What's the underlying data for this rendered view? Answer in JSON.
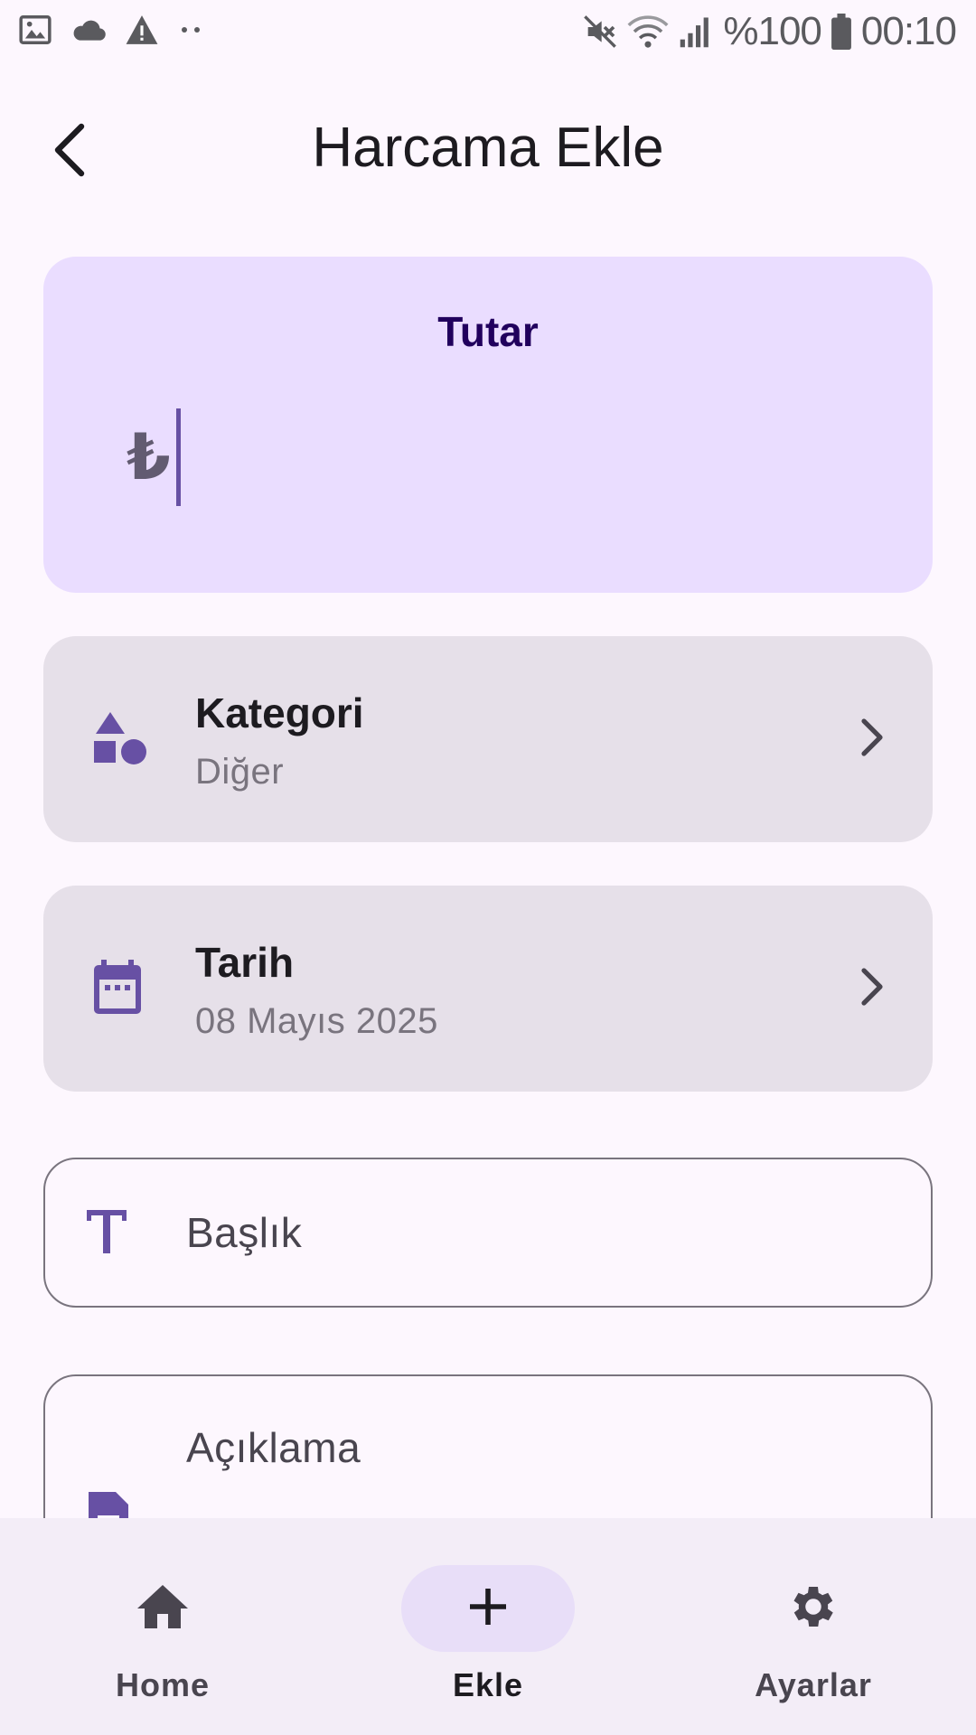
{
  "status_bar": {
    "battery": "%100",
    "time": "00:10",
    "left_icons": [
      "image-icon",
      "cloud-icon",
      "warning-icon",
      "more-dots-icon"
    ],
    "right_icons": [
      "mute-icon",
      "wifi-icon",
      "signal-icon",
      "battery-icon"
    ]
  },
  "header": {
    "title": "Harcama Ekle",
    "back_icon": "arrow-back-icon"
  },
  "amount": {
    "label": "Tutar",
    "currency_symbol": "₺",
    "value": ""
  },
  "category": {
    "title": "Kategori",
    "value": "Diğer",
    "icon": "category-shapes-icon"
  },
  "date": {
    "title": "Tarih",
    "value": "08 Mayıs 2025",
    "icon": "calendar-icon"
  },
  "title_field": {
    "placeholder": "Başlık",
    "icon": "text-title-icon"
  },
  "description_field": {
    "placeholder": "Açıklama",
    "icon": "note-icon"
  },
  "bottom_nav": {
    "items": [
      {
        "label": "Home",
        "icon": "home-icon",
        "active": false
      },
      {
        "label": "Ekle",
        "icon": "add-icon",
        "active": true
      },
      {
        "label": "Ayarlar",
        "icon": "settings-icon",
        "active": false
      }
    ]
  },
  "colors": {
    "background": "#fdf7fe",
    "amount_card": "#eaddff",
    "picker_card": "#e6e0e9",
    "accent": "#6750a4",
    "nav_background": "#f3edf7",
    "nav_active_pill": "#e8def8"
  }
}
